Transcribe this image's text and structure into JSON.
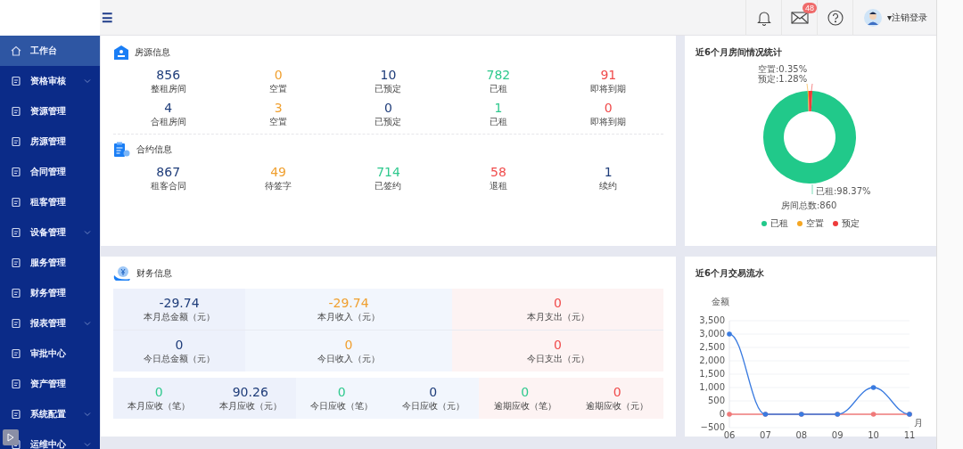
{
  "header": {
    "menu_icon": "☰",
    "mail_badge": "48",
    "logout": "▾注销登录"
  },
  "sidebar": {
    "items": [
      {
        "label": "工作台",
        "selected": true,
        "expandable": false
      },
      {
        "label": "资格审核",
        "selected": false,
        "expandable": true
      },
      {
        "label": "资源管理",
        "selected": false,
        "expandable": false
      },
      {
        "label": "房源管理",
        "selected": false,
        "expandable": false
      },
      {
        "label": "合同管理",
        "selected": false,
        "expandable": false
      },
      {
        "label": "租客管理",
        "selected": false,
        "expandable": false
      },
      {
        "label": "设备管理",
        "selected": false,
        "expandable": true
      },
      {
        "label": "服务管理",
        "selected": false,
        "expandable": false
      },
      {
        "label": "财务管理",
        "selected": false,
        "expandable": false
      },
      {
        "label": "报表管理",
        "selected": false,
        "expandable": true
      },
      {
        "label": "审批中心",
        "selected": false,
        "expandable": false
      },
      {
        "label": "资产管理",
        "selected": false,
        "expandable": false
      },
      {
        "label": "系统配置",
        "selected": false,
        "expandable": true
      },
      {
        "label": "运维中心",
        "selected": false,
        "expandable": true
      }
    ]
  },
  "housing": {
    "title": "房源信息",
    "rows": [
      [
        {
          "value": "856",
          "label": "整租房间",
          "color": "#1f3d7a"
        },
        {
          "value": "0",
          "label": "空置",
          "color": "#f0a030"
        },
        {
          "value": "10",
          "label": "已预定",
          "color": "#1f3d7a"
        },
        {
          "value": "782",
          "label": "已租",
          "color": "#2fc98e"
        },
        {
          "value": "91",
          "label": "即将到期",
          "color": "#f04b4b"
        }
      ],
      [
        {
          "value": "4",
          "label": "合租房间",
          "color": "#1f3d7a"
        },
        {
          "value": "3",
          "label": "空置",
          "color": "#f0a030"
        },
        {
          "value": "0",
          "label": "已预定",
          "color": "#1f3d7a"
        },
        {
          "value": "1",
          "label": "已租",
          "color": "#2fc98e"
        },
        {
          "value": "0",
          "label": "即将到期",
          "color": "#f04b4b"
        }
      ]
    ]
  },
  "contract": {
    "title": "合约信息",
    "rows": [
      [
        {
          "value": "867",
          "label": "租客合同",
          "color": "#1f3d7a"
        },
        {
          "value": "49",
          "label": "待签字",
          "color": "#f0a030"
        },
        {
          "value": "714",
          "label": "已签约",
          "color": "#2fc98e"
        },
        {
          "value": "58",
          "label": "退租",
          "color": "#f04b4b"
        },
        {
          "value": "1",
          "label": "续约",
          "color": "#1f3d7a"
        }
      ]
    ]
  },
  "finance": {
    "title": "财务信息",
    "columns": [
      {
        "color": "#edf1fb",
        "items": [
          {
            "value": "-29.74",
            "label": "本月总金额（元）",
            "color": "#1f3d7a"
          },
          {
            "value": "0",
            "label": "今日总金额（元）",
            "color": "#1f3d7a"
          }
        ]
      },
      {
        "color": "#f2f6fd",
        "items": [
          {
            "value": "-29.74",
            "label": "本月收入（元）",
            "color": "#f0a030"
          },
          {
            "value": "0",
            "label": "今日收入（元）",
            "color": "#f0a030"
          }
        ]
      },
      {
        "color": "#fdf3f3",
        "items": [
          {
            "value": "0",
            "label": "本月支出（元）",
            "color": "#f04b4b"
          },
          {
            "value": "0",
            "label": "今日支出（元）",
            "color": "#f04b4b"
          }
        ]
      }
    ],
    "receivables": [
      {
        "color": "#edf1fb",
        "items": [
          {
            "value": "0",
            "label": "本月应收（笔）",
            "color": "#2fc98e"
          },
          {
            "value": "90.26",
            "label": "本月应收（元）",
            "color": "#1f3d7a"
          }
        ]
      },
      {
        "color": "#f2f6fd",
        "items": [
          {
            "value": "0",
            "label": "今日应收（笔）",
            "color": "#2fc98e"
          },
          {
            "value": "0",
            "label": "今日应收（元）",
            "color": "#1f3d7a"
          }
        ]
      },
      {
        "color": "#fdf3f3",
        "items": [
          {
            "value": "0",
            "label": "逾期应收（笔）",
            "color": "#2fc98e"
          },
          {
            "value": "0",
            "label": "逾期应收（元）",
            "color": "#f04b4b"
          }
        ]
      }
    ]
  },
  "room_chart": {
    "title": "近6个月房间情况统计",
    "total": "房间总数:860",
    "slice_labels": [
      "空置:0.35%",
      "预定:1.28%",
      "已租:98.37%"
    ],
    "chart_data": {
      "type": "donut",
      "categories": [
        "已租",
        "空置",
        "预定"
      ],
      "values": [
        98.37,
        0.35,
        1.28
      ],
      "colors": [
        "#21c98a",
        "#f5a623",
        "#ee3b3b"
      ]
    }
  },
  "flow_chart": {
    "title": "近6个月交易流水",
    "chart_data": {
      "type": "line",
      "grid": true,
      "xlabel": "月",
      "ylabel": "金额",
      "categories": [
        "06",
        "07",
        "08",
        "09",
        "10",
        "11"
      ],
      "series": [
        {
          "color": "#3a7be0",
          "values": [
            3000,
            0,
            0,
            0,
            1000,
            0
          ]
        },
        {
          "color": "#f07a7a",
          "values": [
            0,
            0,
            0,
            0,
            0,
            0
          ]
        }
      ],
      "ylim": [
        -500,
        3500
      ],
      "yticks": [
        {
          "value": -500,
          "label": "−500"
        },
        {
          "value": 0,
          "label": "0"
        },
        {
          "value": 500,
          "label": "500"
        },
        {
          "value": 1000,
          "label": "1,000"
        },
        {
          "value": 1500,
          "label": "1,500"
        },
        {
          "value": 2000,
          "label": "2,000"
        },
        {
          "value": 2500,
          "label": "2,500"
        },
        {
          "value": 3000,
          "label": "3,000"
        },
        {
          "value": 3500,
          "label": "3,500"
        }
      ]
    }
  }
}
